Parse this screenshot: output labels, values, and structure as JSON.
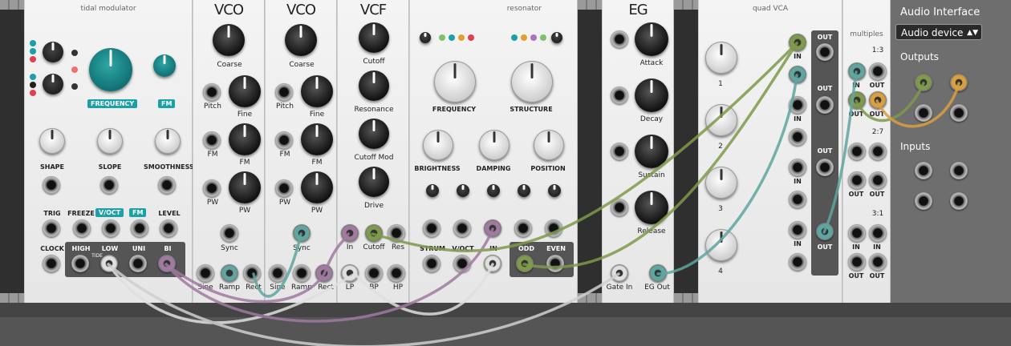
{
  "rack_title": "",
  "modules": {
    "tidal": {
      "title": "tidal modulator",
      "frequency": "FREQUENCY",
      "fm": "FM",
      "shape": "SHAPE",
      "slope": "SLOPE",
      "smoothness": "SMOOTHNESS",
      "trig": "TRIG",
      "freeze": "FREEZE",
      "voct": "V/OCT",
      "fm2": "FM",
      "level": "LEVEL",
      "clock": "CLOCK",
      "high": "HIGH",
      "low": "LOW",
      "uni": "UNI",
      "bi": "BI",
      "tide": "TIDE"
    },
    "vco1": {
      "title": "VCO",
      "coarse": "Coarse",
      "fine": "Fine",
      "pitch": "Pitch",
      "fm": "FM",
      "fm2": "FM",
      "pw": "PW",
      "pw2": "PW",
      "sync": "Sync",
      "sine": "Sine",
      "ramp": "Ramp",
      "rect": "Rect"
    },
    "vco2": {
      "title": "VCO",
      "coarse": "Coarse",
      "fine": "Fine",
      "pitch": "Pitch",
      "fm": "FM",
      "fm2": "FM",
      "pw": "PW",
      "pw2": "PW",
      "sync": "Sync",
      "sine": "Sine",
      "ramp": "Ramp",
      "rect": "Rect"
    },
    "vcf": {
      "title": "VCF",
      "cutoff": "Cutoff",
      "resonance": "Resonance",
      "cutoff_mod": "Cutoff Mod",
      "drive": "Drive",
      "in": "In",
      "cutoff_in": "Cutoff",
      "res": "Res",
      "lp": "LP",
      "bp": "BP",
      "hp": "HP"
    },
    "resonator": {
      "title": "resonator",
      "frequency": "FREQUENCY",
      "structure": "STRUCTURE",
      "brightness": "BRIGHTNESS",
      "damping": "DAMPING",
      "position": "POSITION",
      "strum": "STRUM",
      "voct": "V/OCT",
      "in": "IN",
      "odd": "ODD",
      "even": "EVEN"
    },
    "eg": {
      "title": "EG",
      "attack": "Attack",
      "decay": "Decay",
      "sustain": "Sustain",
      "release": "Release",
      "gate_in": "Gate In",
      "eg_out": "EG Out"
    },
    "quadvca": {
      "title": "quad VCA",
      "in": "IN",
      "out": "OUT",
      "ch1": "1",
      "ch2": "2",
      "ch3": "3",
      "ch4": "4"
    },
    "multiples": {
      "title": "multiples",
      "in": "IN",
      "out": "OUT",
      "r1": "1:3",
      "r2": "2:7",
      "r3": "3:1"
    }
  },
  "audio_interface": {
    "title": "Audio Interface",
    "device": "Audio device",
    "outputs": "Outputs",
    "inputs": "Inputs"
  },
  "colors": {
    "teal": "#1aa0a8",
    "cable_green": "#7f9a4a",
    "cable_teal": "#5fa6a0",
    "cable_purple": "#a07aa0",
    "cable_white": "#e0e0e0",
    "cable_orange": "#d9a040"
  }
}
